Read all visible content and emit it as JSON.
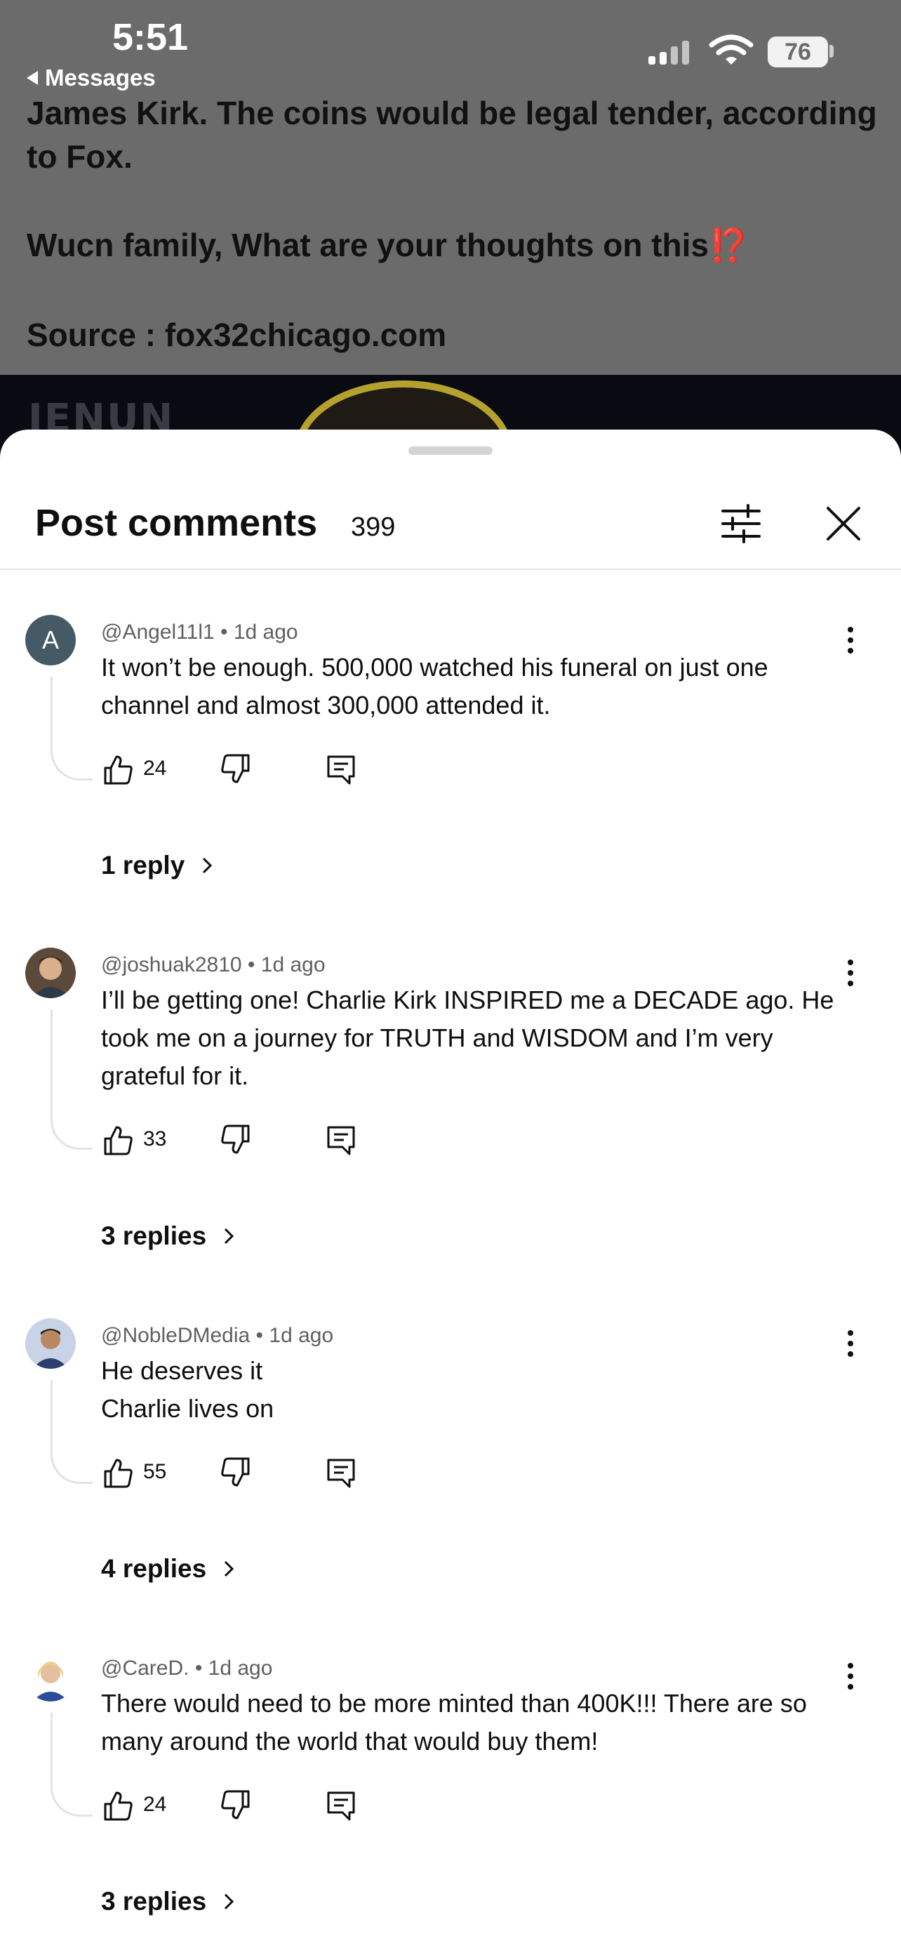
{
  "status_bar": {
    "time": "5:51",
    "back_label": "Messages",
    "battery": "76"
  },
  "post": {
    "text_line1": "James Kirk. The coins would be legal tender, according to Fox.",
    "text_line2": "Wucn family, What are your thoughts on this",
    "text_line2_emoji": "⁉️",
    "text_line3": "Source : fox32chicago.com",
    "image_logo": "JENUN"
  },
  "sheet": {
    "title": "Post comments",
    "count": "399"
  },
  "comments": [
    {
      "avatar_letter": "A",
      "meta": "@Angel11l1 • 1d ago",
      "text": "It won’t be enough. 500,000 watched his funeral on just one channel and almost 300,000 attended it.",
      "likes": "24",
      "replies": "1 reply"
    },
    {
      "avatar_letter": "",
      "meta": "@joshuak2810 • 1d ago",
      "text": "I’ll be getting one! Charlie Kirk INSPIRED me a DECADE ago. He took me on a journey for TRUTH and WISDOM and I’m very grateful for it.",
      "likes": "33",
      "replies": "3 replies"
    },
    {
      "avatar_letter": "",
      "meta": "@NobleDMedia • 1d ago",
      "text_line1": "He deserves it",
      "text_line2": "Charlie lives on",
      "likes": "55",
      "replies": "4 replies"
    },
    {
      "avatar_letter": "",
      "meta": "@CareD. • 1d ago",
      "text": "There would need to be more minted than 400K!!! There are so many around the world that would buy them!",
      "likes": "24",
      "replies": "3 replies"
    }
  ],
  "icons": {
    "filter": "sliders-icon",
    "close": "close-icon",
    "like": "thumbs-up-icon",
    "dislike": "thumbs-down-icon",
    "reply": "comment-icon",
    "more": "more-vert-icon",
    "chevron": "chevron-right-icon"
  },
  "colors": {
    "accent_red": "#c3241a",
    "avatar_a": "#455a64"
  }
}
